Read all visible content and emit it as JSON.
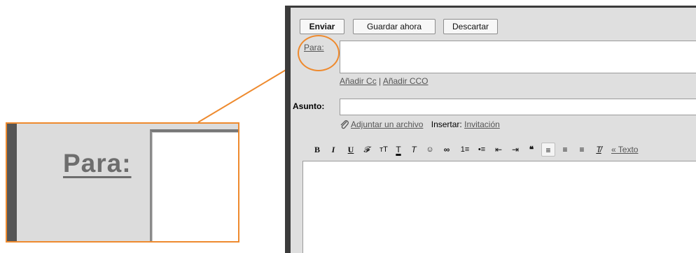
{
  "zoom": {
    "label": "Para:",
    "accent_color": "#ee8a2e"
  },
  "compose": {
    "buttons": {
      "send": "Enviar",
      "save_now": "Guardar ahora",
      "discard": "Descartar"
    },
    "to_label": "Para:",
    "add_cc": "Añadir Cc",
    "separator": "|",
    "add_bcc": "Añadir CCO",
    "subject_label": "Asunto:",
    "attach_link": "Adjuntar un archivo",
    "insert_label": "Insertar:",
    "invitation_link": "Invitación",
    "toolbar": {
      "bold": "B",
      "italic": "I",
      "underline": "U",
      "font": "𝓕",
      "size": "тT",
      "text_color": "T",
      "bg_color": "T",
      "emoji": "☺",
      "link": "∞",
      "numbered_list": "1≡",
      "bulleted_list": "•≡",
      "indent_less": "⇤",
      "indent_more": "⇥",
      "quote": "❝",
      "align_left": "≡",
      "align_center": "≡",
      "align_right": "≡",
      "remove_format": "T̸",
      "plain_text_link": "« Texto"
    }
  }
}
